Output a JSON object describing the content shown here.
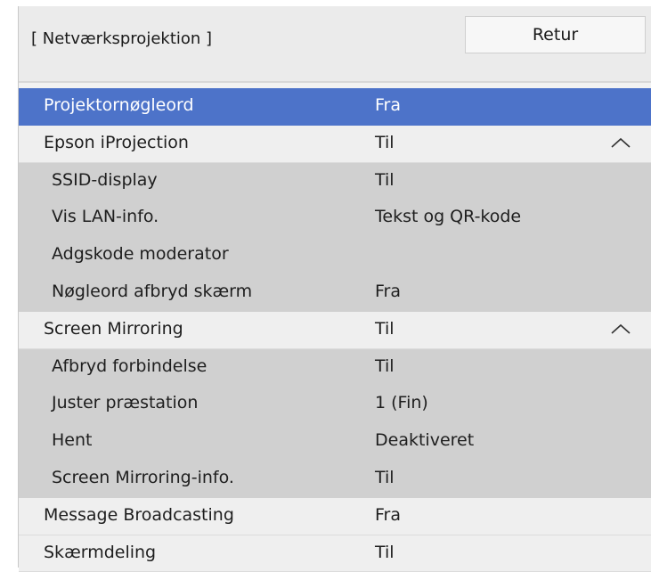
{
  "header": {
    "title": "[ Netværksprojektion ]",
    "return_label": "Retur"
  },
  "rows": [
    {
      "label": "Projektornøgleord",
      "value": "Fra",
      "icon": ""
    },
    {
      "label": "Epson iProjection",
      "value": "Til",
      "icon": "chevron-up-icon"
    },
    {
      "label": "SSID-display",
      "value": "Til"
    },
    {
      "label": "Vis LAN-info.",
      "value": "Tekst og QR-kode"
    },
    {
      "label": "Adgskode moderator",
      "value": ""
    },
    {
      "label": "Nøgleord afbryd skærm",
      "value": "Fra"
    },
    {
      "label": "Screen Mirroring",
      "value": "Til",
      "icon": "chevron-up-icon"
    },
    {
      "label": "Afbryd forbindelse",
      "value": "Til"
    },
    {
      "label": "Juster præstation",
      "value": "1 (Fin)"
    },
    {
      "label": "Hent",
      "value": "Deaktiveret"
    },
    {
      "label": "Screen Mirroring-info.",
      "value": "Til"
    },
    {
      "label": "Message Broadcasting",
      "value": "Fra"
    },
    {
      "label": "Skærmdeling",
      "value": "Til"
    }
  ],
  "colors": {
    "selection": "#4d73c9",
    "submenu": "#d0d0d0",
    "background": "#f2f2f2"
  }
}
